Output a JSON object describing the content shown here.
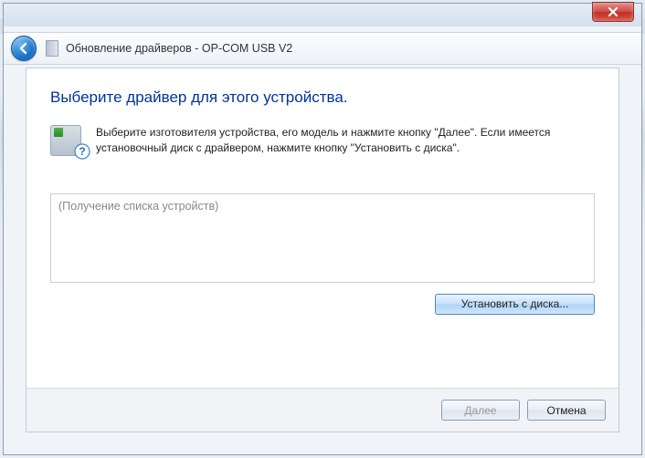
{
  "window": {
    "title": "Обновление драйверов - OP-COM USB V2"
  },
  "heading": "Выберите драйвер для этого устройства.",
  "instruction": "Выберите изготовителя устройства, его модель и нажмите кнопку \"Далее\". Если имеется установочный диск с  драйвером, нажмите кнопку \"Установить с диска\".",
  "list_placeholder": "(Получение списка устройств)",
  "buttons": {
    "install_from_disk": "Установить с диска...",
    "next": "Далее",
    "cancel": "Отмена"
  }
}
